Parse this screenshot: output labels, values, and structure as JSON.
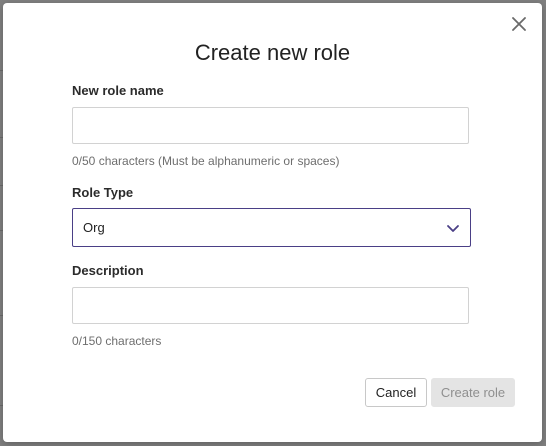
{
  "dialog": {
    "title": "Create new role",
    "close_icon": "close-icon"
  },
  "role_name": {
    "label": "New role name",
    "value": "",
    "placeholder": "",
    "hint": "0/50 characters (Must be alphanumeric or spaces)"
  },
  "role_type": {
    "label": "Role Type",
    "selected": "Org",
    "chevron_icon": "chevron-down-icon"
  },
  "description": {
    "label": "Description",
    "value": "",
    "placeholder": "",
    "hint": "0/150 characters"
  },
  "actions": {
    "cancel_label": "Cancel",
    "create_label": "Create role"
  },
  "colors": {
    "select_border": "#4a3f86",
    "disabled_button_bg": "#e4e4e4",
    "disabled_button_text": "#8f8f8f",
    "backdrop": "#808080"
  }
}
